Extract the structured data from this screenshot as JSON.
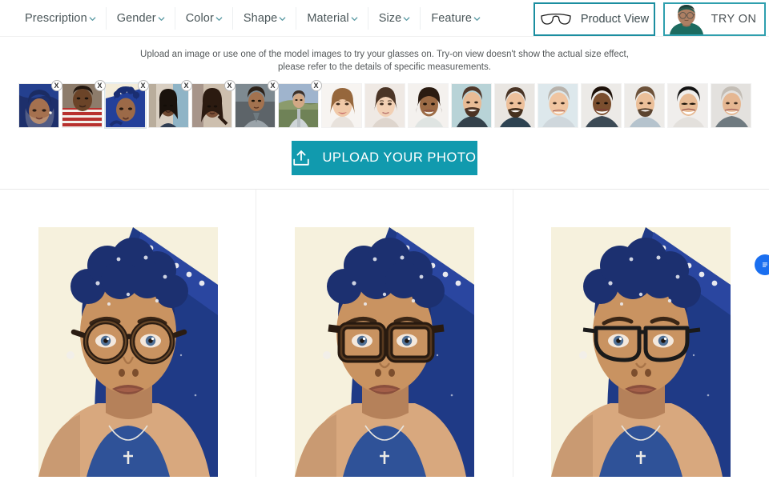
{
  "nav": {
    "filters": [
      {
        "label": "Prescription",
        "icon": "chevron-down-icon"
      },
      {
        "label": "Gender",
        "icon": "chevron-down-icon"
      },
      {
        "label": "Color",
        "icon": "chevron-down-icon"
      },
      {
        "label": "Shape",
        "icon": "chevron-down-icon"
      },
      {
        "label": "Material",
        "icon": "chevron-down-icon"
      },
      {
        "label": "Size",
        "icon": "chevron-down-icon"
      },
      {
        "label": "Feature",
        "icon": "chevron-down-icon"
      }
    ]
  },
  "view_toggle": {
    "product_view_label": "Product View",
    "product_view_icon": "glasses-icon",
    "try_on_label": "TRY ON",
    "try_on_icon": "avatar-with-glasses-icon",
    "active": "TRY ON",
    "border_color": "#1b8ea0"
  },
  "tryon_panel": {
    "hint": "Upload an image or use one of the model images to try your glasses on. Try-on view doesn't show the actual size effect, please refer to the details of specific measurements.",
    "upload_button": {
      "label": "UPLOAD YOUR PHOTO",
      "icon": "upload-icon",
      "background": "#119aae",
      "text_color": "#ffffff"
    },
    "delete_icon_label": "X",
    "thumbnails": [
      {
        "type": "user-photo",
        "name": "user-photo-1",
        "deletable": true,
        "selected": false
      },
      {
        "type": "user-photo",
        "name": "user-photo-2",
        "deletable": true,
        "selected": false
      },
      {
        "type": "user-photo",
        "name": "user-photo-3",
        "deletable": true,
        "selected": true
      },
      {
        "type": "user-photo",
        "name": "user-photo-4",
        "deletable": true,
        "selected": false
      },
      {
        "type": "user-photo",
        "name": "user-photo-5",
        "deletable": true,
        "selected": false
      },
      {
        "type": "user-photo",
        "name": "user-photo-6",
        "deletable": true,
        "selected": false
      },
      {
        "type": "user-photo",
        "name": "user-photo-7",
        "deletable": true,
        "selected": false
      },
      {
        "type": "model",
        "name": "model-1",
        "deletable": false,
        "selected": false
      },
      {
        "type": "model",
        "name": "model-2",
        "deletable": false,
        "selected": false
      },
      {
        "type": "model",
        "name": "model-3",
        "deletable": false,
        "selected": false
      },
      {
        "type": "model",
        "name": "model-4",
        "deletable": false,
        "selected": false
      },
      {
        "type": "model",
        "name": "model-5",
        "deletable": false,
        "selected": false
      },
      {
        "type": "model",
        "name": "model-6",
        "deletable": false,
        "selected": false
      },
      {
        "type": "model",
        "name": "model-7",
        "deletable": false,
        "selected": false
      },
      {
        "type": "model",
        "name": "model-8",
        "deletable": false,
        "selected": false
      },
      {
        "type": "model",
        "name": "model-9",
        "deletable": false,
        "selected": false
      },
      {
        "type": "model",
        "name": "model-10",
        "deletable": false,
        "selected": false
      }
    ]
  },
  "product_grid": {
    "cards": [
      {
        "name": "product-card-1",
        "frame_style": "round",
        "frame_color": "#2a1c12"
      },
      {
        "name": "product-card-2",
        "frame_style": "rectangle-thick",
        "frame_color": "#281a10"
      },
      {
        "name": "product-card-3",
        "frame_style": "rectangle-thin",
        "frame_color": "#1a1a1a"
      }
    ]
  },
  "chat_widget": {
    "icon": "chat-bubble-icon",
    "color": "#1a6ff0"
  }
}
